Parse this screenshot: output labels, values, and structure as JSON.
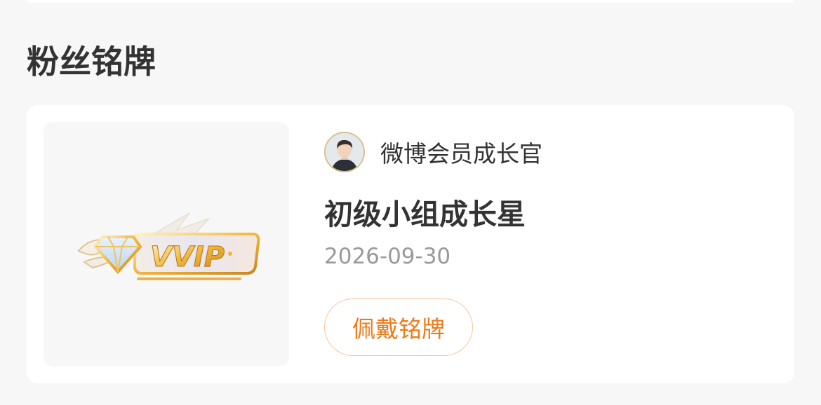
{
  "section": {
    "title": "粉丝铭牌"
  },
  "medal_card": {
    "issuer_name": "微博会员成长官",
    "medal_name": "初级小组成长星",
    "expire_date": "2026-09-30",
    "wear_button_label": "佩戴铭牌",
    "badge_image_text": "VVIP"
  },
  "colors": {
    "accent": "#ec7b1a",
    "button_border": "#f3c79b",
    "title_text": "#333333",
    "muted_text": "#9a9a9a",
    "page_background": "#f7f7f7",
    "card_background": "#ffffff"
  }
}
